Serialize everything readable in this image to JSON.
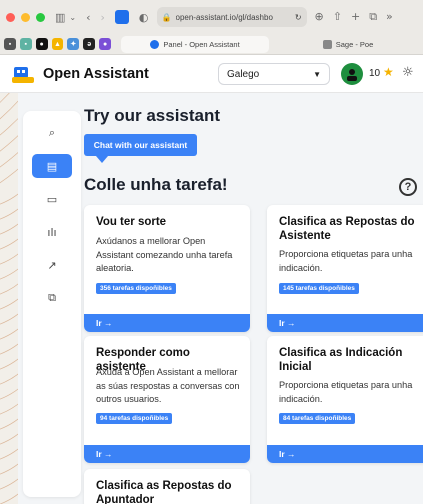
{
  "browser": {
    "url": "open-assistant.io/gl/dashbo",
    "tabs": [
      {
        "label": "Panel - Open Assistant"
      },
      {
        "label": "Sage - Poe"
      }
    ]
  },
  "header": {
    "title": "Open Assistant",
    "language": "Galego",
    "score": "10"
  },
  "main": {
    "try_heading": "Try our assistant",
    "chat_button": "Chat with our assistant",
    "task_heading": "Colle unha tarefa!",
    "help_glyph": "?"
  },
  "cards": [
    {
      "title": "Vou ter sorte",
      "desc": "Axúdanos a mellorar Open Assistant comezando unha tarefa aleatoria.",
      "badge": "356 tarefas dispoñibles",
      "action": "Ir →"
    },
    {
      "title": "Clasifica as Repostas do Asistente",
      "desc": "Proporciona etiquetas para unha indicación.",
      "badge": "145 tarefas dispoñibles",
      "action": "Ir →"
    },
    {
      "title": "Responder como asistente",
      "desc": "Axuda a Open Assistant a mellorar as súas respostas a conversas con outros usuarios.",
      "badge": "94 tarefas dispoñibles",
      "action": "Ir →"
    },
    {
      "title": "Clasifica as Indicación Inicial",
      "desc": "Proporciona etiquetas para unha indicación.",
      "badge": "84 tarefas dispoñibles",
      "action": "Ir →"
    },
    {
      "title": "Clasifica as Repostas do Apuntador"
    }
  ],
  "colors": {
    "accent": "#3b82f6",
    "avatar": "#1e8e3e",
    "star": "#f5b301"
  },
  "icons": {
    "sidebar": [
      "search-icon",
      "dashboard-icon",
      "messages-icon",
      "stats-icon",
      "trending-icon",
      "external-link-icon"
    ]
  }
}
